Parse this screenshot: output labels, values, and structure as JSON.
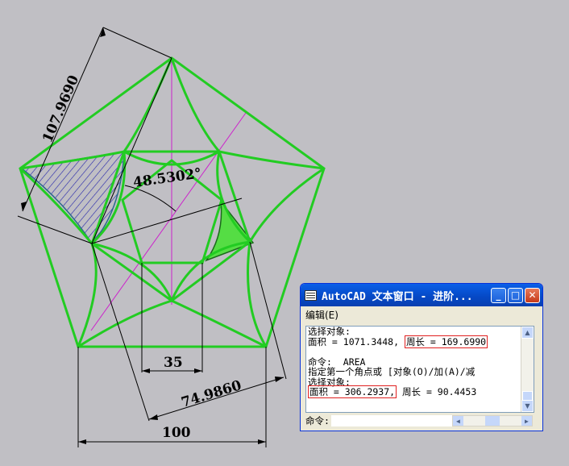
{
  "drawing": {
    "dim_diagonal": "107.9690",
    "dim_angle": "48.5302°",
    "dim_inner": "35",
    "dim_slant": "74.9860",
    "dim_bottom": "100",
    "colors": {
      "pentagon": "#22cc22",
      "axis": "#cc22cc",
      "hatch": "#2222aa",
      "fill": "#55dd44"
    }
  },
  "window": {
    "title": "AutoCAD 文本窗口 - 进阶...",
    "menu_edit": "编辑(E)",
    "lines": [
      {
        "a": "选择对象:",
        "h": "",
        "b": ""
      },
      {
        "a": "面积 = 1071.3448, ",
        "h": "周长 = 169.6990",
        "b": ""
      },
      {
        "a": "",
        "h": "",
        "b": ""
      },
      {
        "a": "命令:  AREA",
        "h": "",
        "b": ""
      },
      {
        "a": "指定第一个角点或 [对象(O)/加(A)/减",
        "h": "",
        "b": ""
      },
      {
        "a": "选择对象:",
        "h": "",
        "b": ""
      },
      {
        "a": "",
        "h": "面积 = 306.2937,",
        "b": " 周长 = 90.4453"
      }
    ],
    "command_prompt": "命令:"
  }
}
